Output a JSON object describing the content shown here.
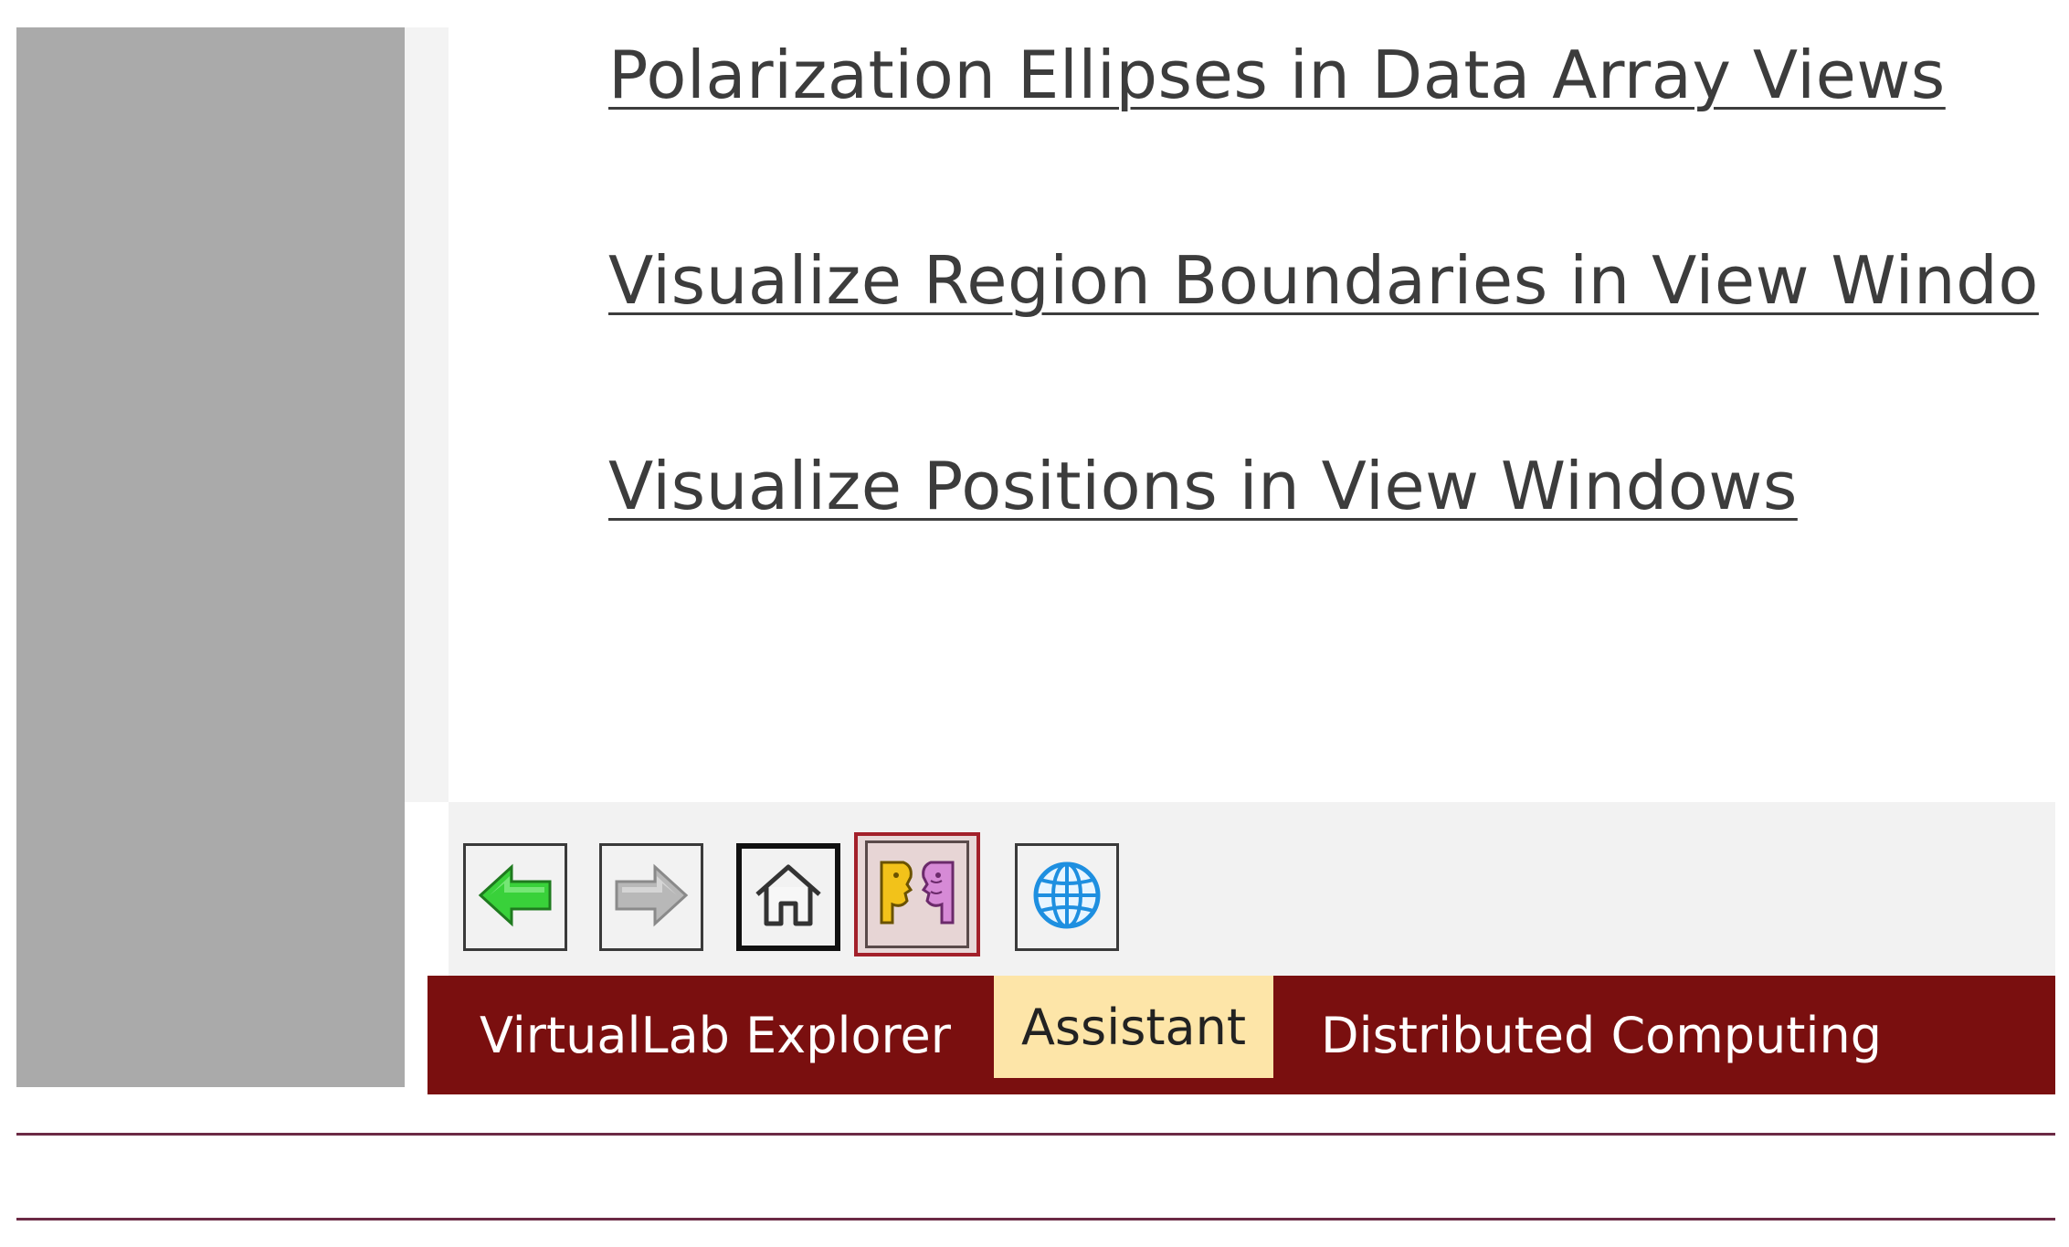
{
  "topics": [
    {
      "label": "Polarization Ellipses in Data Array Views"
    },
    {
      "label": "Visualize Region Boundaries in View Windo"
    },
    {
      "label": "Visualize Positions in View Windows"
    }
  ],
  "toolbar": {
    "back_icon": "back-arrow-icon",
    "forward_icon": "forward-arrow-icon",
    "home_icon": "home-icon",
    "assistant_icon": "assistant-faces-icon",
    "web_icon": "globe-icon"
  },
  "tabs": [
    {
      "label": "VirtualLab Explorer",
      "active": false
    },
    {
      "label": "Assistant",
      "active": true
    },
    {
      "label": "Distributed Computing",
      "active": false
    }
  ],
  "colors": {
    "tab_bar": "#7a0f0f",
    "active_tab": "#fde5a8",
    "selected_button_border": "#a3202a",
    "rule": "#6b2a45",
    "back_arrow": "#33cc33",
    "globe": "#1e8fe0"
  }
}
